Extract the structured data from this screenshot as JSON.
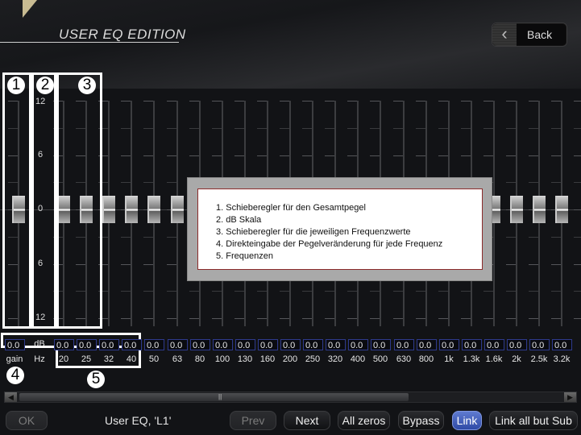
{
  "header": {
    "title": "USER EQ EDITION",
    "back_label": "Back"
  },
  "scale": {
    "labels": [
      "12",
      "6",
      "0",
      "6",
      "12"
    ],
    "unit": "dB",
    "range_db": [
      -12,
      12
    ]
  },
  "annotations": {
    "markers": [
      "1",
      "2",
      "3",
      "4",
      "5"
    ],
    "legend": [
      "1. Schieberegler für den Gesamtpegel",
      "2. dB Skala",
      "3. Schieberegler für die jeweiligen Frequenzwerte",
      "4. Direkteingabe der Pegelveränderung für jede Frequenz",
      "5. Frequenzen"
    ]
  },
  "gain": {
    "label": "gain",
    "value": "0.0",
    "db_label": "dB",
    "hz_label": "Hz"
  },
  "bands": [
    {
      "freq": "20",
      "value": "0.0"
    },
    {
      "freq": "25",
      "value": "0.0"
    },
    {
      "freq": "32",
      "value": "0.0"
    },
    {
      "freq": "40",
      "value": "0.0"
    },
    {
      "freq": "50",
      "value": "0.0"
    },
    {
      "freq": "63",
      "value": "0.0"
    },
    {
      "freq": "80",
      "value": "0.0"
    },
    {
      "freq": "100",
      "value": "0.0"
    },
    {
      "freq": "130",
      "value": "0.0"
    },
    {
      "freq": "160",
      "value": "0.0"
    },
    {
      "freq": "200",
      "value": "0.0"
    },
    {
      "freq": "250",
      "value": "0.0"
    },
    {
      "freq": "320",
      "value": "0.0"
    },
    {
      "freq": "400",
      "value": "0.0"
    },
    {
      "freq": "500",
      "value": "0.0"
    },
    {
      "freq": "630",
      "value": "0.0"
    },
    {
      "freq": "800",
      "value": "0.0"
    },
    {
      "freq": "1k",
      "value": "0.0"
    },
    {
      "freq": "1.3k",
      "value": "0.0"
    },
    {
      "freq": "1.6k",
      "value": "0.0"
    },
    {
      "freq": "2k",
      "value": "0.0"
    },
    {
      "freq": "2.5k",
      "value": "0.0"
    },
    {
      "freq": "3.2k",
      "value": "0.0"
    }
  ],
  "scrollbar": {
    "position_fraction": 0.0,
    "visible_fraction": 0.72
  },
  "footer": {
    "ok_label": "OK",
    "status": "User EQ, 'L1'",
    "prev_label": "Prev",
    "next_label": "Next",
    "all_zeros_label": "All zeros",
    "bypass_label": "Bypass",
    "link_label": "Link",
    "link_all_but_sub_label": "Link all but Sub"
  },
  "colors": {
    "accent": "#3f5fc0",
    "field_border": "#2e3a8c",
    "overlay_border": "#8b2a2a"
  }
}
